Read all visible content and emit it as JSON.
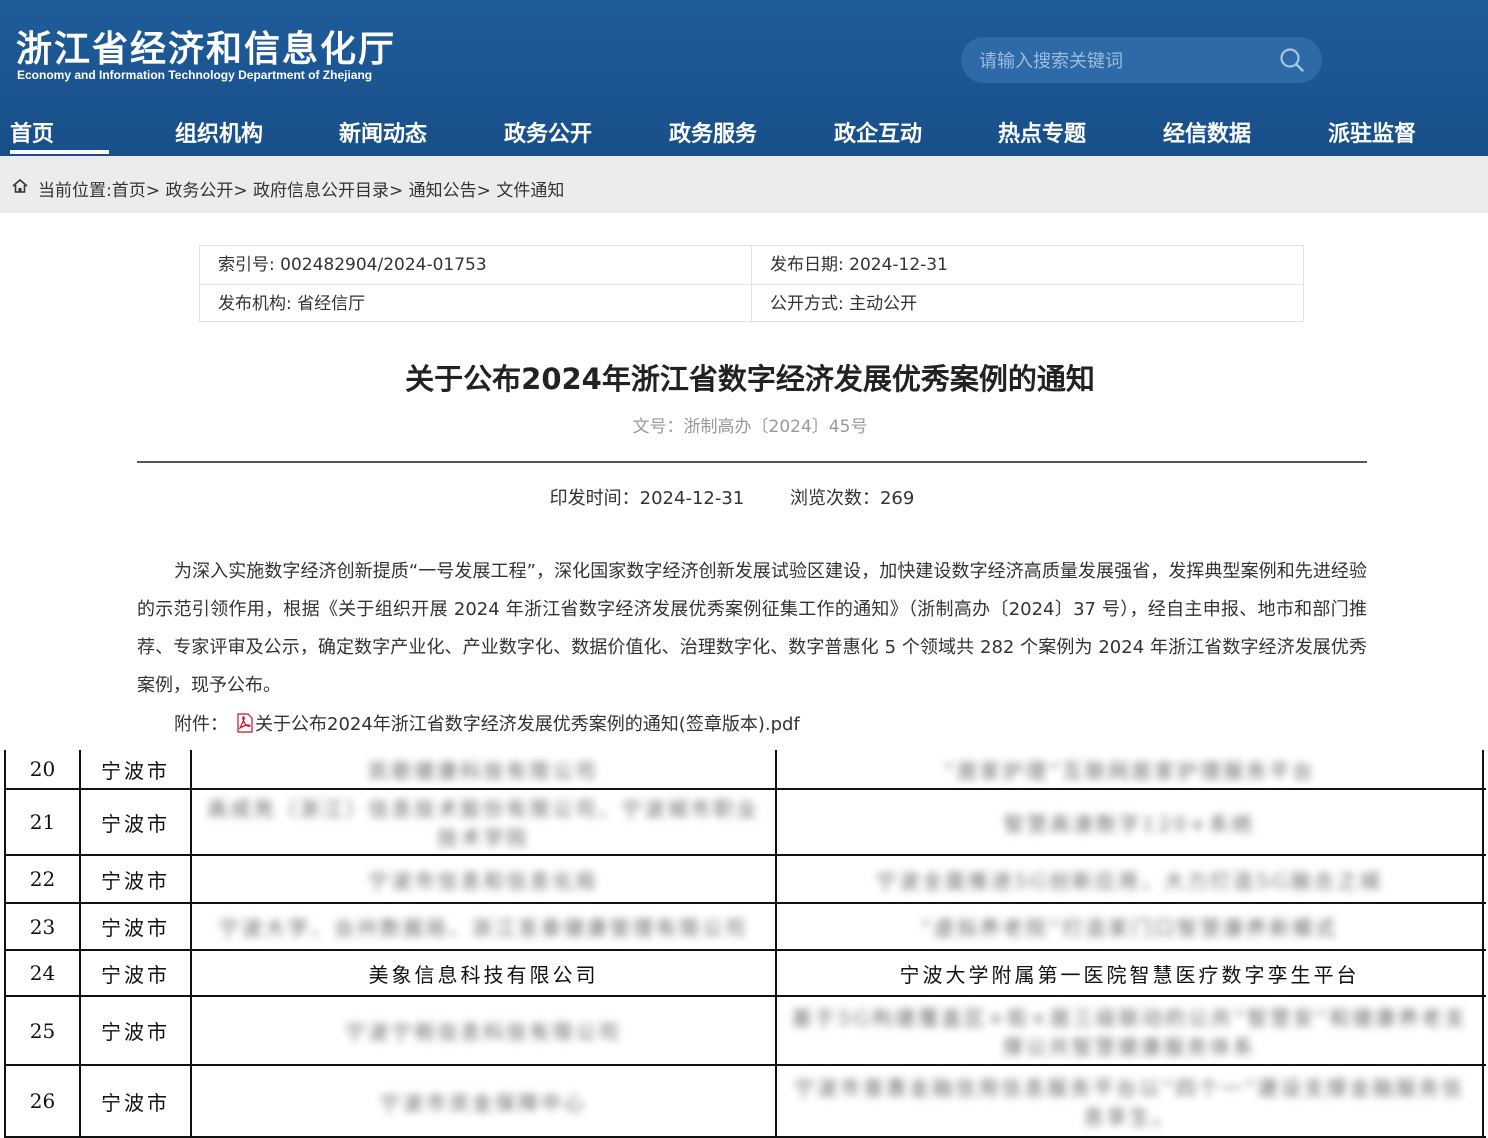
{
  "header": {
    "title_cn": "浙江省经济和信息化厅",
    "title_en": "Economy and Information Technology Department of Zhejiang",
    "search_placeholder": "请输入搜索关键词",
    "nav": [
      "首页",
      "组织机构",
      "新闻动态",
      "政务公开",
      "政务服务",
      "政企互动",
      "热点专题",
      "经信数据",
      "派驻监督"
    ],
    "active_nav": "首页"
  },
  "breadcrumb": "当前位置:首页> 政务公开> 政府信息公开目录> 通知公告> 文件通知",
  "meta": {
    "index_no": "索引号: 002482904/2024-01753",
    "pub_date": "发布日期: 2024-12-31",
    "issuer": "发布机构: 省经信厅",
    "disclosure": "公开方式: 主动公开"
  },
  "article": {
    "title": "关于公布2024年浙江省数字经济发展优秀案例的通知",
    "doc_no": "文号：浙制高办〔2024〕45号",
    "print_time": "印发时间：2024-12-31",
    "views": "浏览次数：269",
    "body": "为深入实施数字经济创新提质“一号发展工程”，深化国家数字经济创新发展试验区建设，加快建设数字经济高质量发展强省，发挥典型案例和先进经验的示范引领作用，根据《关于组织开展 2024 年浙江省数字经济发展优秀案例征集工作的通知》（浙制高办〔2024〕37 号），经自主申报、地市和部门推荐、专家评审及公示，确定数字产业化、产业数字化、数据价值化、治理数字化、数字普惠化 5 个领域共 282 个案例为 2024 年浙江省数字经济发展优秀案例，现予公布。",
    "attachment_label": "附件：",
    "attachment_name": "关于公布2024年浙江省数字经济发展优秀案例的通知(签章版本).pdf"
  },
  "table_rows": [
    {
      "no": "20",
      "city": "宁波市",
      "org": "凯歌健康科技有限公司",
      "case": "“居家护理”互联网居家护理服务平台",
      "blurred": true
    },
    {
      "no": "21",
      "city": "宁波市",
      "org": "高成亮（浙江）信息技术股份有限公司、宁波城市职业技术学院",
      "case": "智慧高速数字120+系统",
      "blurred": true
    },
    {
      "no": "22",
      "city": "宁波市",
      "org": "宁波市信息和信息化局",
      "case": "宁波全面推进5G创新应用，大力打造5G融合之城",
      "blurred": true
    },
    {
      "no": "23",
      "city": "宁波市",
      "org": "宁波大学、台州数据局、浙江圣泰健康管理有限公司",
      "case": "“虚拟养老院”打造家门口智慧康养新模式",
      "blurred": true
    },
    {
      "no": "24",
      "city": "宁波市",
      "org": "美象信息科技有限公司",
      "case": "宁波大学附属第一医院智慧医疗数字孪生平台",
      "blurred": false
    },
    {
      "no": "25",
      "city": "宁波市",
      "org": "宁波宁税信息科技有限公司",
      "case": "基于5G构建覆盖区+街+居三级联动的公共“智慧安”和健康养老支撑公共智慧健康服务体系",
      "blurred": true
    },
    {
      "no": "26",
      "city": "宁波市",
      "org": "宁波市资金保障中心",
      "case": "宁波市普惠金融信用信息服务平台以“四个一”建设支撑金融服务信息孪生。",
      "blurred": true
    }
  ]
}
